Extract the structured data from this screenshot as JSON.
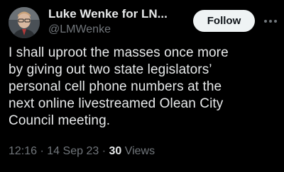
{
  "author": {
    "display_name": "Luke Wenke for LN...",
    "handle": "@LMWenke"
  },
  "header": {
    "follow_label": "Follow"
  },
  "tweet": {
    "text_lines": [
      "I shall uproot the masses once more",
      "by giving out two state legislators’",
      "personal cell phone numbers at the",
      "next online livestreamed Olean City",
      "Council meeting."
    ],
    "time": "12:16",
    "separator": "·",
    "date": "14 Sep 23",
    "views_count": "30",
    "views_label": "Views"
  },
  "icons": {
    "avatar": "profile-photo",
    "more": "more-icon"
  },
  "colors": {
    "background": "#000000",
    "primary_text": "#e7e9ea",
    "secondary_text": "#71767b",
    "follow_button_bg": "#eff3f4",
    "follow_button_text": "#0f1419"
  }
}
